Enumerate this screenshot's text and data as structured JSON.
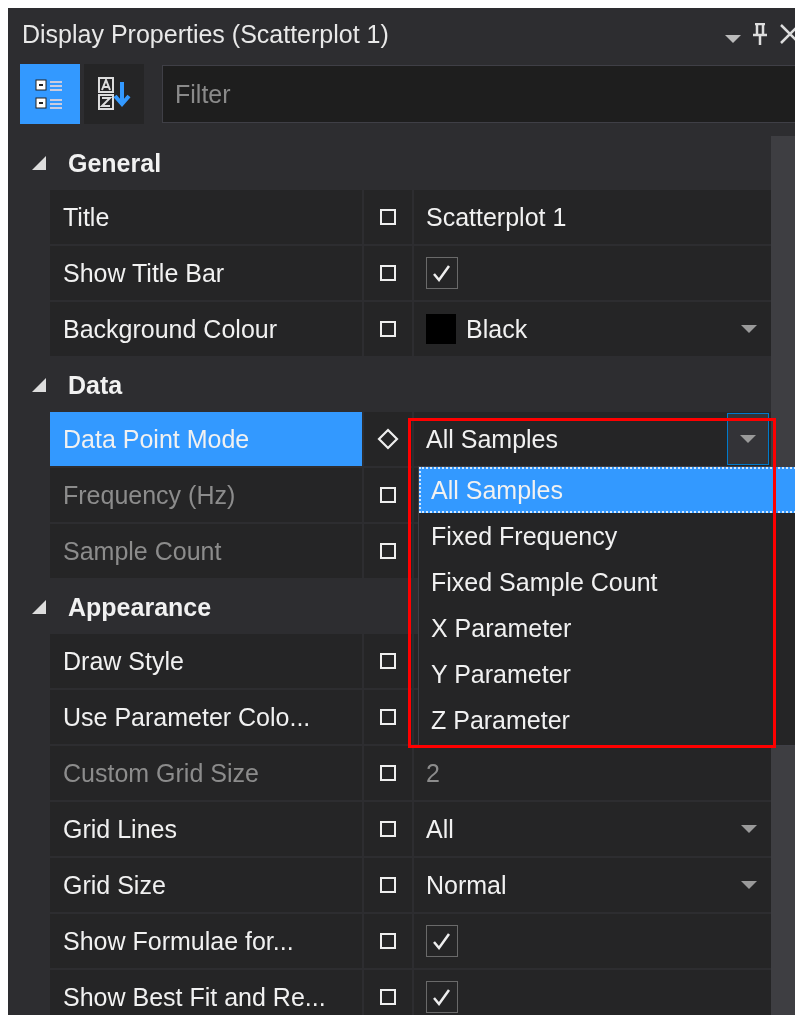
{
  "window": {
    "title": "Display Properties (Scatterplot 1)"
  },
  "toolbar": {
    "buttons": [
      {
        "kind": "categorized",
        "selected": true
      },
      {
        "kind": "alphabetical",
        "selected": false
      }
    ],
    "filter": {
      "placeholder": "Filter"
    }
  },
  "sections": [
    {
      "title": "General",
      "expanded": true,
      "properties": [
        {
          "name": "Title",
          "kind": "text",
          "value": "Scatterplot 1",
          "modified": false,
          "disabled": false,
          "selected": false
        },
        {
          "name": "Show Title Bar",
          "kind": "checkbox",
          "checked": true,
          "modified": false,
          "disabled": false,
          "selected": false
        },
        {
          "name": "Background Colour",
          "kind": "color",
          "value": "Black",
          "color": "#000000",
          "modified": false,
          "disabled": false,
          "selected": false
        }
      ]
    },
    {
      "title": "Data",
      "expanded": true,
      "properties": [
        {
          "name": "Data Point Mode",
          "kind": "dropdown",
          "value": "All Samples",
          "modified": true,
          "disabled": false,
          "selected": true,
          "open": true,
          "highlighted": true,
          "options": [
            {
              "label": "All Samples",
              "selected": true
            },
            {
              "label": "Fixed Frequency",
              "selected": false
            },
            {
              "label": "Fixed Sample Count",
              "selected": false
            },
            {
              "label": "X Parameter",
              "selected": false
            },
            {
              "label": "Y Parameter",
              "selected": false
            },
            {
              "label": "Z Parameter",
              "selected": false
            }
          ]
        },
        {
          "name": "Frequency (Hz)",
          "kind": "hidden",
          "modified": false,
          "disabled": true,
          "selected": false
        },
        {
          "name": "Sample Count",
          "kind": "hidden",
          "modified": false,
          "disabled": true,
          "selected": false
        }
      ]
    },
    {
      "title": "Appearance",
      "expanded": true,
      "properties": [
        {
          "name": "Draw Style",
          "kind": "hidden",
          "modified": false,
          "disabled": false,
          "selected": false
        },
        {
          "name": "Use Parameter Colo...",
          "kind": "hidden",
          "modified": false,
          "disabled": false,
          "selected": false
        },
        {
          "name": "Custom Grid Size",
          "kind": "text",
          "value": "2",
          "modified": false,
          "disabled": true,
          "selected": false
        },
        {
          "name": "Grid Lines",
          "kind": "dropdown",
          "value": "All",
          "modified": false,
          "disabled": false,
          "selected": false
        },
        {
          "name": "Grid Size",
          "kind": "dropdown",
          "value": "Normal",
          "modified": false,
          "disabled": false,
          "selected": false
        },
        {
          "name": "Show Formulae for...",
          "kind": "checkbox",
          "checked": true,
          "modified": false,
          "disabled": false,
          "selected": false
        },
        {
          "name": "Show Best Fit and Re...",
          "kind": "checkbox",
          "checked": true,
          "modified": false,
          "disabled": false,
          "selected": false
        }
      ]
    }
  ]
}
